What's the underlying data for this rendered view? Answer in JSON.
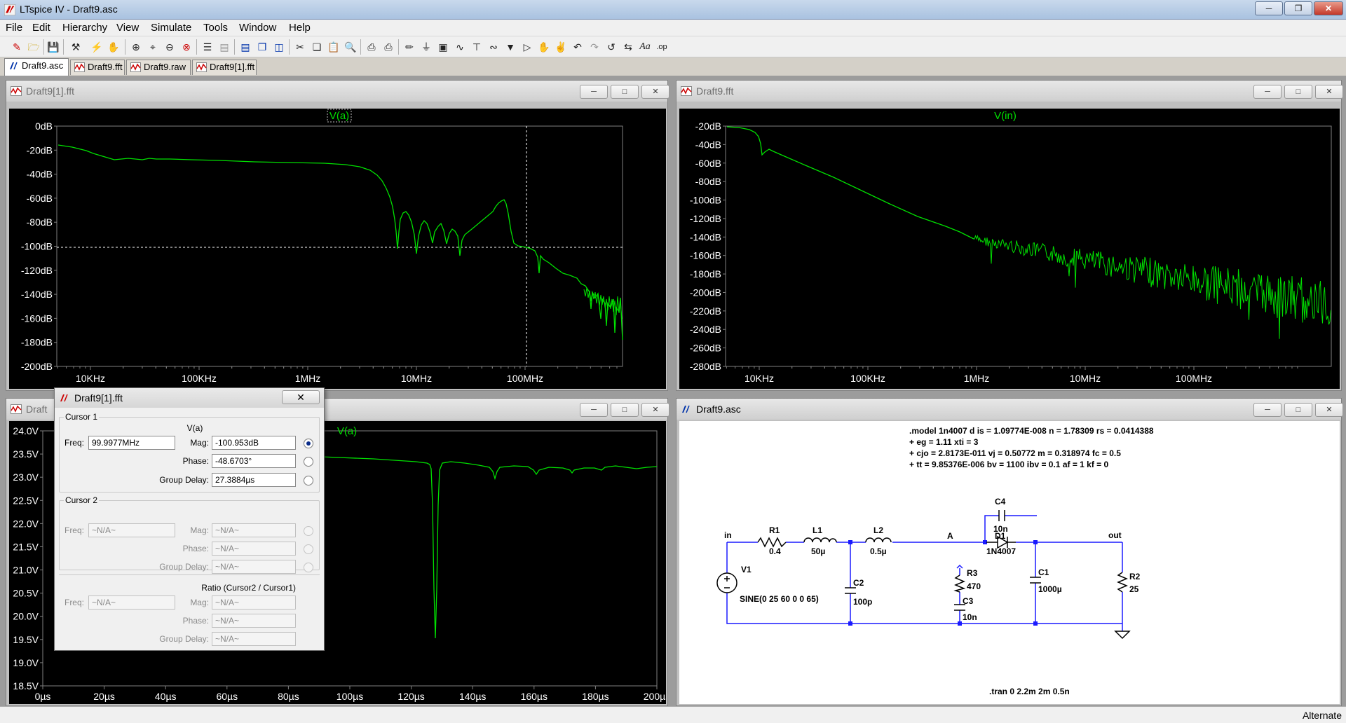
{
  "app": {
    "title": "LTspice IV - Draft9.asc"
  },
  "menu": [
    "File",
    "Edit",
    "Hierarchy",
    "View",
    "Simulate",
    "Tools",
    "Window",
    "Help"
  ],
  "tabs": [
    {
      "label": "Draft9.asc",
      "active": true
    },
    {
      "label": "Draft9.fft",
      "active": false
    },
    {
      "label": "Draft9.raw",
      "active": false
    },
    {
      "label": "Draft9[1].fft",
      "active": false
    }
  ],
  "windows": {
    "fft1": {
      "title": "Draft9[1].fft",
      "trace": "V(a)",
      "y_ticks": [
        "0dB",
        "-20dB",
        "-40dB",
        "-60dB",
        "-80dB",
        "-100dB",
        "-120dB",
        "-140dB",
        "-160dB",
        "-180dB",
        "-200dB"
      ],
      "x_ticks": [
        "10KHz",
        "100KHz",
        "1MHz",
        "10MHz",
        "100MHz"
      ]
    },
    "fft0": {
      "title": "Draft9.fft",
      "trace": "V(in)",
      "y_ticks": [
        "-20dB",
        "-40dB",
        "-60dB",
        "-80dB",
        "-100dB",
        "-120dB",
        "-140dB",
        "-160dB",
        "-180dB",
        "-200dB",
        "-220dB",
        "-240dB",
        "-260dB",
        "-280dB"
      ],
      "x_ticks": [
        "10KHz",
        "100KHz",
        "1MHz",
        "10MHz",
        "100MHz"
      ]
    },
    "raw": {
      "title": "Draft9.raw",
      "title_visible": "Draft",
      "trace": "V(a)",
      "y_ticks": [
        "24.0V",
        "23.5V",
        "23.0V",
        "22.5V",
        "22.0V",
        "21.5V",
        "21.0V",
        "20.5V",
        "20.0V",
        "19.5V",
        "19.0V",
        "18.5V"
      ],
      "x_ticks": [
        "0µs",
        "20µs",
        "40µs",
        "60µs",
        "80µs",
        "100µs",
        "120µs",
        "140µs",
        "160µs",
        "180µs",
        "200µs"
      ]
    },
    "schematic": {
      "title": "Draft9.asc",
      "model_lines": [
        ".model 1n4007 d is = 1.09774E-008 n = 1.78309 rs = 0.0414388",
        "+ eg = 1.11 xti = 3",
        "+ cjo = 2.8173E-011 vj = 0.50772 m = 0.318974 fc = 0.5",
        "+ tt = 9.85376E-006 bv = 1100 ibv = 0.1 af = 1 kf = 0"
      ],
      "labels": {
        "in": "in",
        "A": "A",
        "out": "out",
        "R1": "R1",
        "R1v": "0.4",
        "L1": "L1",
        "L1v": "50µ",
        "L2": "L2",
        "L2v": "0.5µ",
        "C4": "C4",
        "C4v": "10n",
        "D1": "D1",
        "D1v": "1N4007",
        "V1": "V1",
        "V1v": "SINE(0 25 60 0 0 65)",
        "C2": "C2",
        "C2v": "100p",
        "R3": "R3",
        "R3v": "470",
        "C3": "C3",
        "C3v": "10n",
        "C1": "C1",
        "C1v": "1000µ",
        "R2": "R2",
        "R2v": "25"
      },
      "directive": ".tran 0 2.2m 2m 0.5n"
    }
  },
  "dialog": {
    "title": "Draft9[1].fft",
    "close": "✕",
    "cursor1": {
      "group": "Cursor 1",
      "trace": "V(a)",
      "freq_label": "Freq:",
      "freq": "99.9977MHz",
      "mag_label": "Mag:",
      "mag": "-100.953dB",
      "phase_label": "Phase:",
      "phase": "-48.6703°",
      "gd_label": "Group Delay:",
      "gd": "27.3884µs"
    },
    "cursor2": {
      "group": "Cursor 2",
      "freq_label": "Freq:",
      "freq": "~N/A~",
      "mag_label": "Mag:",
      "mag": "~N/A~",
      "phase_label": "Phase:",
      "phase": "~N/A~",
      "gd_label": "Group Delay:",
      "gd": "~N/A~"
    },
    "ratio": {
      "title": "Ratio (Cursor2 / Cursor1)",
      "freq_label": "Freq:",
      "freq": "~N/A~",
      "mag_label": "Mag:",
      "mag": "~N/A~",
      "phase_label": "Phase:",
      "phase": "~N/A~",
      "gd_label": "Group Delay:",
      "gd": "~N/A~"
    }
  },
  "status": {
    "right": "Alternate"
  },
  "colors": {
    "trace": "#00e000",
    "plot_bg": "#000000",
    "schematic_wire": "#1a1aff"
  }
}
